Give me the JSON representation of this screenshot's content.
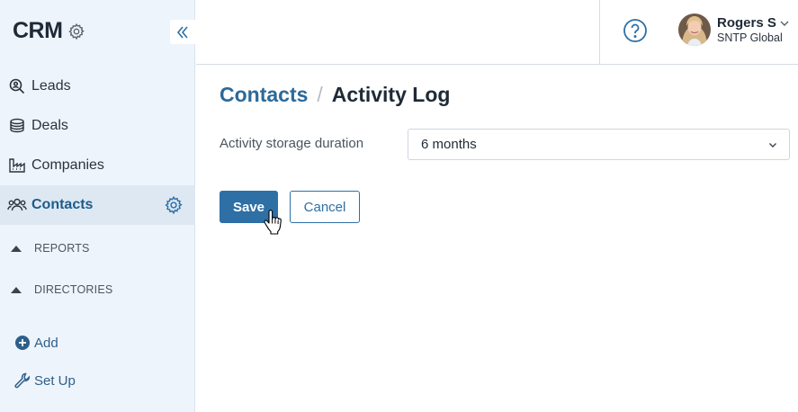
{
  "sidebar": {
    "brand": "CRM",
    "nav": [
      {
        "label": "Leads",
        "icon": "search-leads-icon"
      },
      {
        "label": "Deals",
        "icon": "coins-icon"
      },
      {
        "label": "Companies",
        "icon": "factory-icon"
      },
      {
        "label": "Contacts",
        "icon": "people-icon",
        "active": true
      }
    ],
    "sections": [
      "REPORTS",
      "DIRECTORIES"
    ],
    "actions": [
      {
        "label": "Add",
        "icon": "plus-circle-icon"
      },
      {
        "label": "Set Up",
        "icon": "wrench-icon"
      }
    ]
  },
  "header": {
    "user_name": "Rogers S",
    "user_org": "SNTP Global"
  },
  "breadcrumb": {
    "parent": "Contacts",
    "separator": "/",
    "current": "Activity Log"
  },
  "form": {
    "field_label": "Activity storage duration",
    "selected_value": "6 months",
    "save_label": "Save",
    "cancel_label": "Cancel"
  },
  "colors": {
    "accent": "#2e6fa5",
    "link": "#2b6a9a",
    "sidebar_bg": "#eef4fb",
    "sidebar_active_bg": "#dde8f3"
  }
}
